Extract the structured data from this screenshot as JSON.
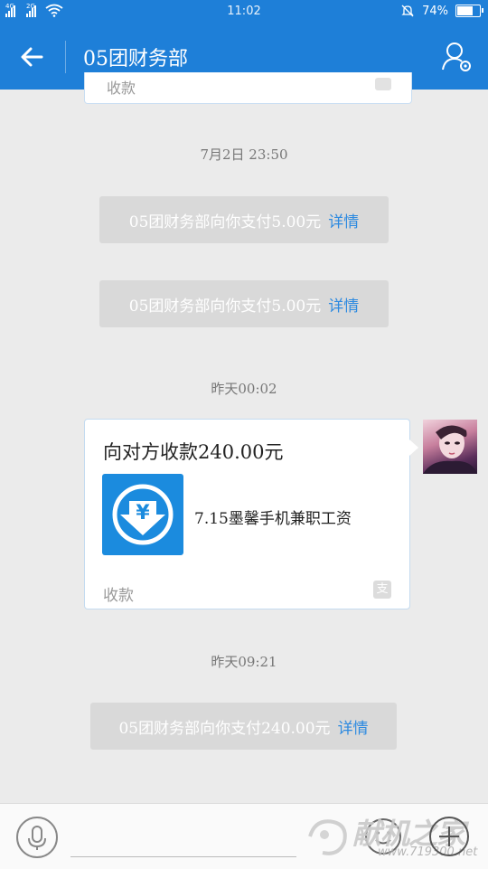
{
  "status_bar": {
    "net1": "4G",
    "net2": "2G",
    "time": "11:02",
    "battery": "74%",
    "battery_level": 0.74
  },
  "header": {
    "title": "05团财务部"
  },
  "partial_card": {
    "label": "收款"
  },
  "messages": {
    "ts1": "7月2日  23:50",
    "pay1": {
      "text": "05团财务部向你支付5.00元",
      "link": "详情"
    },
    "pay2": {
      "text": "05团财务部向你支付5.00元",
      "link": "详情"
    },
    "ts2": "昨天00:02",
    "request": {
      "title": "向对方收款240.00元",
      "description": "7.15墨馨手机兼职工资",
      "footer": "收款",
      "thumb_icon": "yuan-download-icon",
      "brand_icon": "alipay-icon"
    },
    "ts3": "昨天09:21",
    "pay3": {
      "text": "05团财务部向你支付240.00元",
      "link": "详情"
    }
  },
  "bottom": {
    "watermark_text": "献机之家",
    "watermark_url": "www.719300.net"
  },
  "colors": {
    "accent": "#1e7fd8",
    "link": "#2d8ae0",
    "background": "#ebebeb",
    "sysmsg_bg": "#d9d9d9"
  }
}
